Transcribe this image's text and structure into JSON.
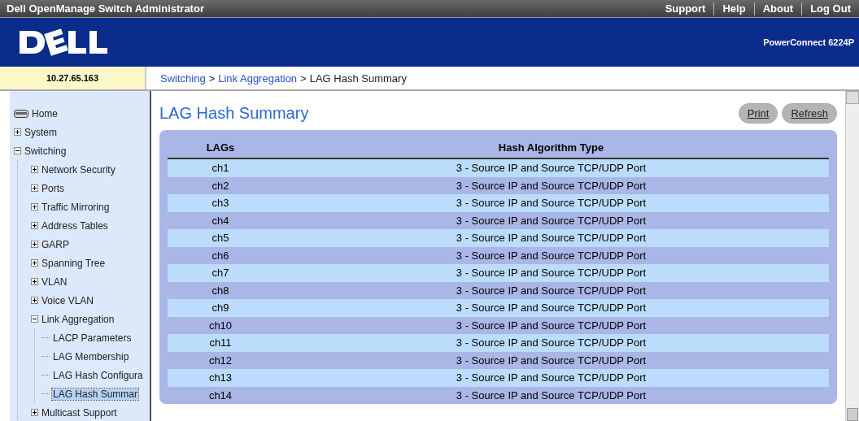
{
  "top_bar": {
    "title": "Dell OpenManage Switch Administrator",
    "links": [
      "Support",
      "Help",
      "About",
      "Log Out"
    ]
  },
  "banner": {
    "model": "PowerConnect 6224P"
  },
  "address": "10.27.65.163",
  "breadcrumb": {
    "links": [
      "Switching",
      "Link Aggregation"
    ],
    "separator": ">",
    "current": "LAG Hash Summary"
  },
  "sidebar": {
    "items": [
      {
        "label": "Home",
        "kind": "home"
      },
      {
        "label": "System",
        "kind": "folder",
        "expanded": false
      },
      {
        "label": "Switching",
        "kind": "folder",
        "expanded": true,
        "children": [
          {
            "label": "Network Security",
            "kind": "folder",
            "expanded": false
          },
          {
            "label": "Ports",
            "kind": "folder",
            "expanded": false
          },
          {
            "label": "Traffic Mirroring",
            "kind": "folder",
            "expanded": false
          },
          {
            "label": "Address Tables",
            "kind": "folder",
            "expanded": false
          },
          {
            "label": "GARP",
            "kind": "folder",
            "expanded": false
          },
          {
            "label": "Spanning Tree",
            "kind": "folder",
            "expanded": false
          },
          {
            "label": "VLAN",
            "kind": "folder",
            "expanded": false
          },
          {
            "label": "Voice VLAN",
            "kind": "folder",
            "expanded": false
          },
          {
            "label": "Link Aggregation",
            "kind": "folder",
            "expanded": true,
            "children": [
              {
                "label": "LACP Parameters",
                "kind": "page",
                "selected": false
              },
              {
                "label": "LAG Membership",
                "kind": "page",
                "selected": false
              },
              {
                "label": "LAG Hash Configura",
                "kind": "page",
                "selected": false
              },
              {
                "label": "LAG Hash Summar",
                "kind": "page",
                "selected": true
              }
            ]
          },
          {
            "label": "Multicast Support",
            "kind": "folder",
            "expanded": false
          }
        ]
      }
    ]
  },
  "page_title": "LAG Hash Summary",
  "buttons": [
    "Print",
    "Refresh"
  ],
  "table": {
    "columns": [
      "LAGs",
      "Hash Algorithm Type"
    ],
    "rows": [
      [
        "ch1",
        "3 - Source IP and Source TCP/UDP Port"
      ],
      [
        "ch2",
        "3 - Source IP and Source TCP/UDP Port"
      ],
      [
        "ch3",
        "3 - Source IP and Source TCP/UDP Port"
      ],
      [
        "ch4",
        "3 - Source IP and Source TCP/UDP Port"
      ],
      [
        "ch5",
        "3 - Source IP and Source TCP/UDP Port"
      ],
      [
        "ch6",
        "3 - Source IP and Source TCP/UDP Port"
      ],
      [
        "ch7",
        "3 - Source IP and Source TCP/UDP Port"
      ],
      [
        "ch8",
        "3 - Source IP and Source TCP/UDP Port"
      ],
      [
        "ch9",
        "3 - Source IP and Source TCP/UDP Port"
      ],
      [
        "ch10",
        "3 - Source IP and Source TCP/UDP Port"
      ],
      [
        "ch11",
        "3 - Source IP and Source TCP/UDP Port"
      ],
      [
        "ch12",
        "3 - Source IP and Source TCP/UDP Port"
      ],
      [
        "ch13",
        "3 - Source IP and Source TCP/UDP Port"
      ],
      [
        "ch14",
        "3 - Source IP and Source TCP/UDP Port"
      ]
    ]
  }
}
